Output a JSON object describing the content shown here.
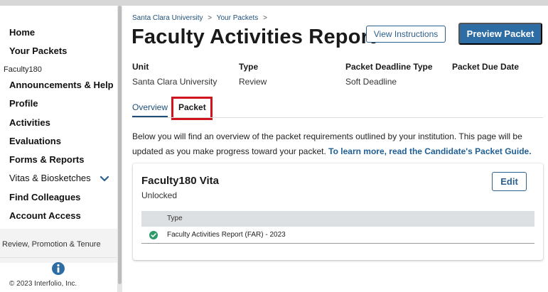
{
  "sidebar": {
    "items": [
      {
        "label": "Home"
      },
      {
        "label": "Your Packets"
      },
      {
        "label": "Faculty180"
      },
      {
        "label": "Announcements & Help"
      },
      {
        "label": "Profile"
      },
      {
        "label": "Activities"
      },
      {
        "label": "Evaluations"
      },
      {
        "label": "Forms & Reports"
      },
      {
        "label": "Vitas & Biosketches"
      },
      {
        "label": "Find Colleagues"
      },
      {
        "label": "Account Access"
      },
      {
        "label": "Review, Promotion & Tenure"
      }
    ],
    "copyright": "© 2023 Interfolio, Inc."
  },
  "breadcrumb": {
    "items": [
      "Santa Clara University",
      "Your Packets"
    ],
    "separator": ">"
  },
  "header": {
    "title": "Faculty Activities Report",
    "view_instructions_label": "View Instructions",
    "preview_packet_label": "Preview Packet"
  },
  "meta": {
    "unit_label": "Unit",
    "unit_value": "Santa Clara University",
    "type_label": "Type",
    "type_value": "Review",
    "deadline_type_label": "Packet Deadline Type",
    "deadline_type_value": "Soft Deadline",
    "due_date_label": "Packet Due Date"
  },
  "tabs": [
    {
      "label": "Overview"
    },
    {
      "label": "Packet"
    }
  ],
  "description": {
    "text": "Below you will find an overview of the packet requirements outlined by your institution. This page will be updated as you make progress toward your packet. ",
    "link": "To learn more, read the Candidate's Packet Guide."
  },
  "card": {
    "title": "Faculty180 Vita",
    "status": "Unlocked",
    "edit_label": "Edit",
    "table_header": "Type",
    "rows": [
      {
        "type": "Faculty Activities Report (FAR) - 2023",
        "status": "complete"
      }
    ]
  },
  "colors": {
    "primary": "#2e6da4",
    "link": "#1f5f96",
    "highlight": "#d0141e",
    "check": "#2e9a6a"
  }
}
